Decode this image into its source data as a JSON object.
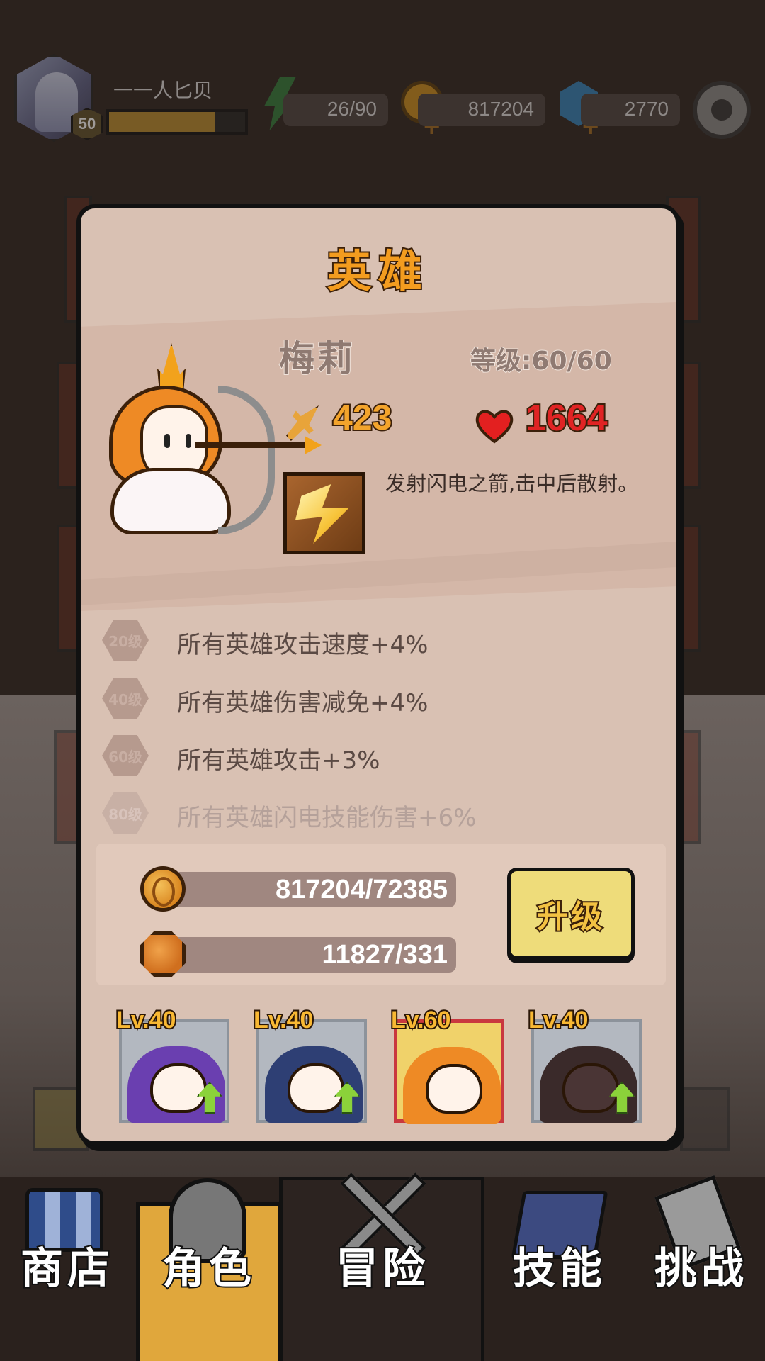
{
  "player": {
    "name": "一一人匕贝",
    "level": "50",
    "xp_fraction": 0.78
  },
  "resources": {
    "energy": "26/90",
    "gold": "817204",
    "gems": "2770"
  },
  "modal": {
    "title": "英雄",
    "hero": {
      "name": "梅莉",
      "level_text": "等级:60/60",
      "attack": "423",
      "hp": "1664",
      "skill_description": "发射闪电之箭,击中后散射。"
    },
    "unlocks": [
      {
        "badge": "20级",
        "text": "所有英雄攻击速度+4%",
        "unlocked": true
      },
      {
        "badge": "40级",
        "text": "所有英雄伤害减免+4%",
        "unlocked": true
      },
      {
        "badge": "60级",
        "text": "所有英雄攻击+3%",
        "unlocked": true
      },
      {
        "badge": "80级",
        "text": "所有英雄闪电技能伤害+6%",
        "unlocked": false
      }
    ],
    "cost": {
      "gold": "817204/72385",
      "shards": "11827/331"
    },
    "upgrade_label": "升级",
    "team": [
      {
        "level": "Lv.40",
        "hero": "purple-hood-hero",
        "color": "#6a3fb0",
        "can_upgrade": true
      },
      {
        "level": "Lv.40",
        "hero": "pirate-hero",
        "color": "#2e3f74",
        "can_upgrade": true
      },
      {
        "level": "Lv.60",
        "hero": "elf-archer-hero",
        "color": "#ee8a25",
        "can_upgrade": false,
        "selected": true
      },
      {
        "level": "Lv.40",
        "hero": "demon-hero",
        "color": "#3a2a2a",
        "can_upgrade": true
      }
    ]
  },
  "bottom_nav": [
    {
      "label": "商店",
      "icon": "shop-icon"
    },
    {
      "label": "角色",
      "icon": "helmet-icon",
      "active": true
    },
    {
      "label": "冒险",
      "icon": "crossed-swords-icon"
    },
    {
      "label": "技能",
      "icon": "spellbook-icon"
    },
    {
      "label": "挑战",
      "icon": "sword-flag-icon"
    }
  ],
  "colors": {
    "accent_orange": "#f39c1f",
    "hp_red": "#e02424",
    "upgrade_yellow": "#eedc7a",
    "modal_bg": "#d9c1b3"
  }
}
